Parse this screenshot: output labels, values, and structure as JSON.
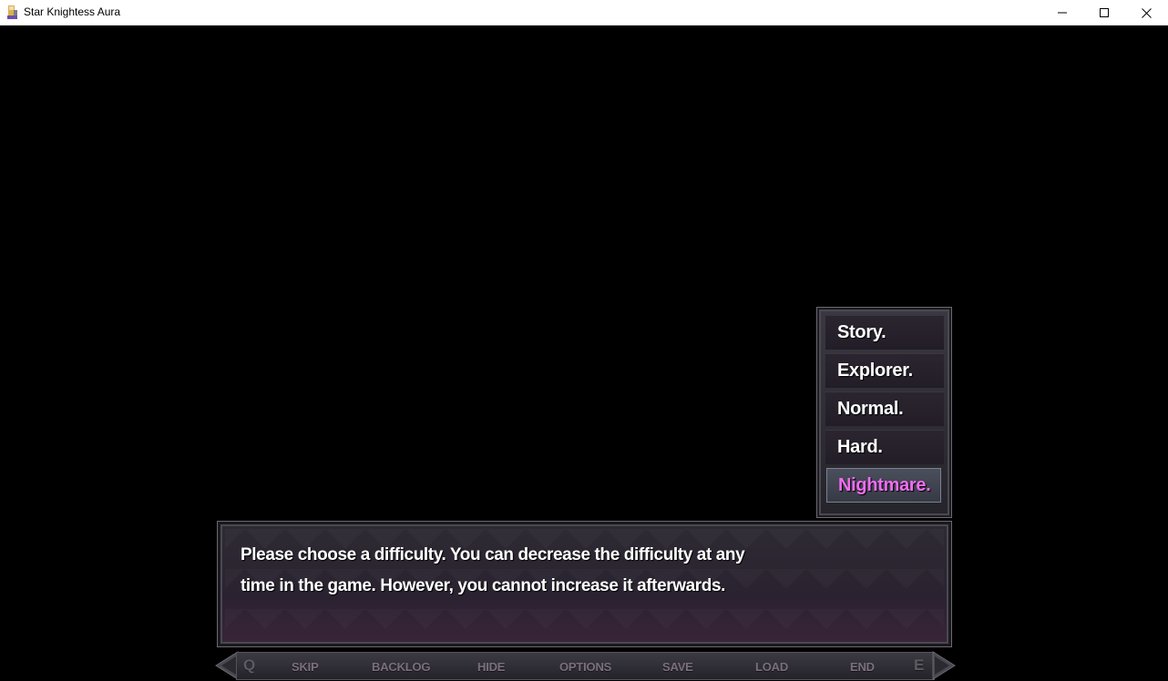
{
  "window": {
    "title": "Star Knightess Aura",
    "controls": [
      "minimize-icon",
      "maximize-icon",
      "close-icon"
    ]
  },
  "choices": [
    {
      "label": "Story.",
      "selected": false
    },
    {
      "label": "Explorer.",
      "selected": false
    },
    {
      "label": "Normal.",
      "selected": false
    },
    {
      "label": "Hard.",
      "selected": false
    },
    {
      "label": "Nightmare.",
      "selected": true
    }
  ],
  "dialogue": {
    "line1": "Please choose a difficulty. You can decrease the difficulty at any",
    "line2": "time in the game. However, you cannot increase it afterwards."
  },
  "quick_menu": {
    "left_key": "Q",
    "right_key": "E",
    "items": [
      "SKIP",
      "BACKLOG",
      "HIDE",
      "OPTIONS",
      "SAVE",
      "LOAD",
      "END"
    ]
  },
  "colors": {
    "selected_choice": "#f26cf2",
    "choice_text": "#ffffff",
    "quick_menu_text": "#7a6f7c"
  }
}
